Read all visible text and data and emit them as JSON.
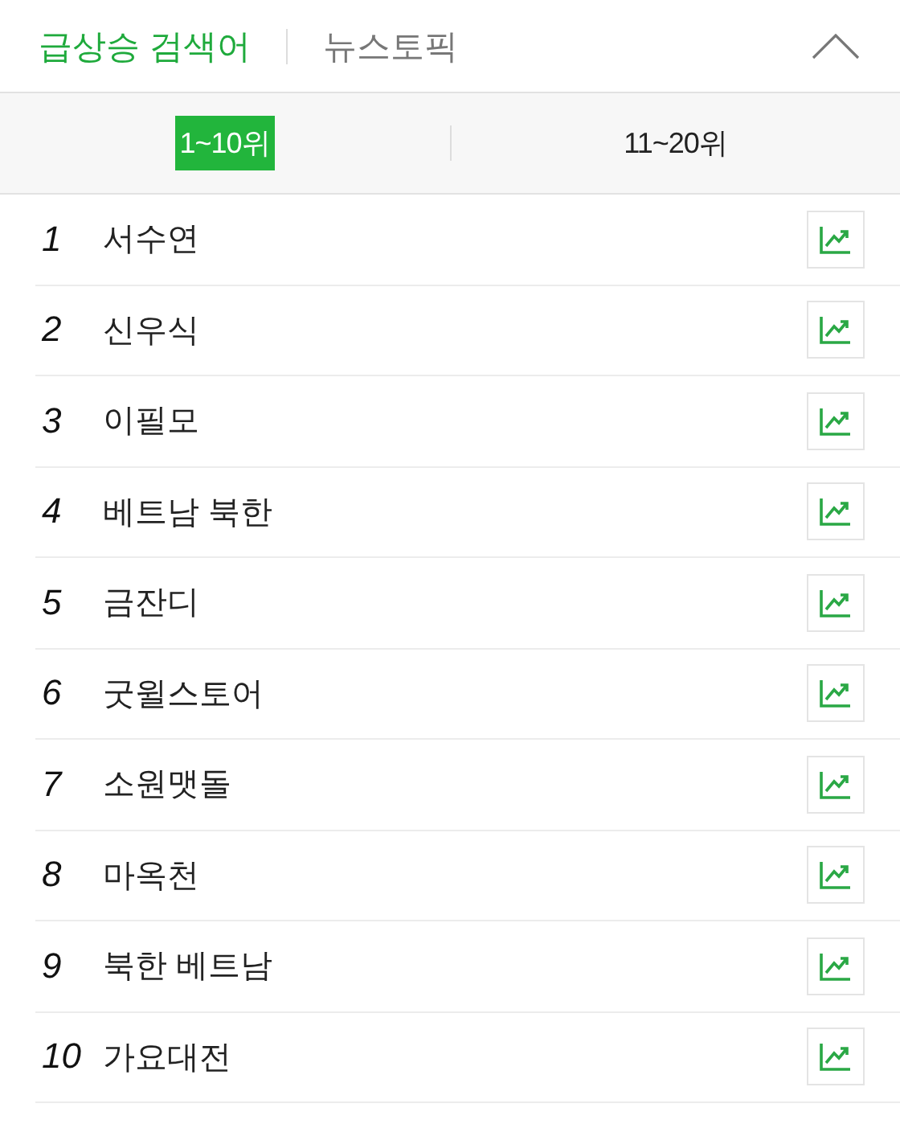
{
  "tabs": [
    {
      "label": "급상승 검색어",
      "selected": true
    },
    {
      "label": "뉴스토픽",
      "selected": false
    }
  ],
  "range_tabs": [
    {
      "label": "1~10위",
      "selected": true
    },
    {
      "label": "11~20위",
      "selected": false
    }
  ],
  "keywords": [
    {
      "rank": "1",
      "term": "서수연"
    },
    {
      "rank": "2",
      "term": "신우식"
    },
    {
      "rank": "3",
      "term": "이필모"
    },
    {
      "rank": "4",
      "term": "베트남 북한"
    },
    {
      "rank": "5",
      "term": "금잔디"
    },
    {
      "rank": "6",
      "term": "굿윌스토어"
    },
    {
      "rank": "7",
      "term": "소원맷돌"
    },
    {
      "rank": "8",
      "term": "마옥천"
    },
    {
      "rank": "9",
      "term": "북한 베트남"
    },
    {
      "rank": "10",
      "term": "가요대전"
    }
  ]
}
